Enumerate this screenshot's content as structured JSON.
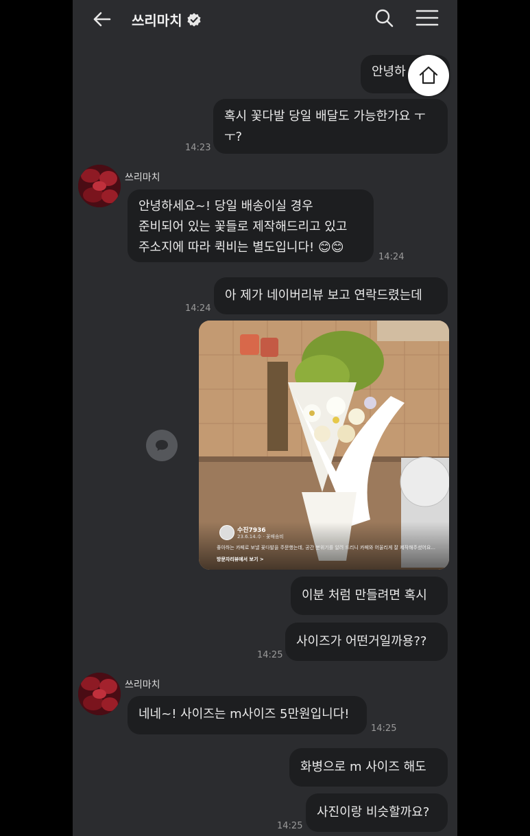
{
  "header": {
    "title": "쓰리마치"
  },
  "messages": {
    "m1": "안녕하",
    "m2_line1": "혹시 꽃다발 당일 배달도 가능한가요 ㅜ",
    "m2_line2": "ㅜ?",
    "t1": "14:23",
    "sender1": "쓰리마치",
    "m3_line1": "안녕하세요~! 당일 배송이실 경우",
    "m3_line2": "준비되어 있는 꽃들로 제작해드리고 있고",
    "m3_line3": "주소지에 따라 퀵비는 별도입니다! 😊😊",
    "t2": "14:24",
    "m4": "아 제가 네이버리뷰 보고 연락드렸는데",
    "t3": "14:24",
    "m5": "이분 처럼 만들려면 혹시",
    "m6": "사이즈가 어떤거일까용??",
    "t4": "14:25",
    "sender2": "쓰리마치",
    "m7": "네네~! 사이즈는 m사이즈 5만원입니다!",
    "t5": "14:25",
    "m8": "화병으로 m 사이즈 해도",
    "m9": "사진이랑 비슷할까요?",
    "t6": "14:25"
  },
  "photo_overlay": {
    "name": "수진7936",
    "meta": "23.6.14.수 · 꽃배송비",
    "desc": "좋아하는 카페로 보낼 꽃다발을 주문했는데, 공간 분위기를 알려 드리니 카페와 어울리게 잘 제작해주셨어요...",
    "link": "방문자리뷰에서 보기 >"
  },
  "icons": [
    "back-arrow-icon",
    "verified-badge-icon",
    "search-icon",
    "menu-icon",
    "home-icon",
    "share-bubble-icon"
  ]
}
